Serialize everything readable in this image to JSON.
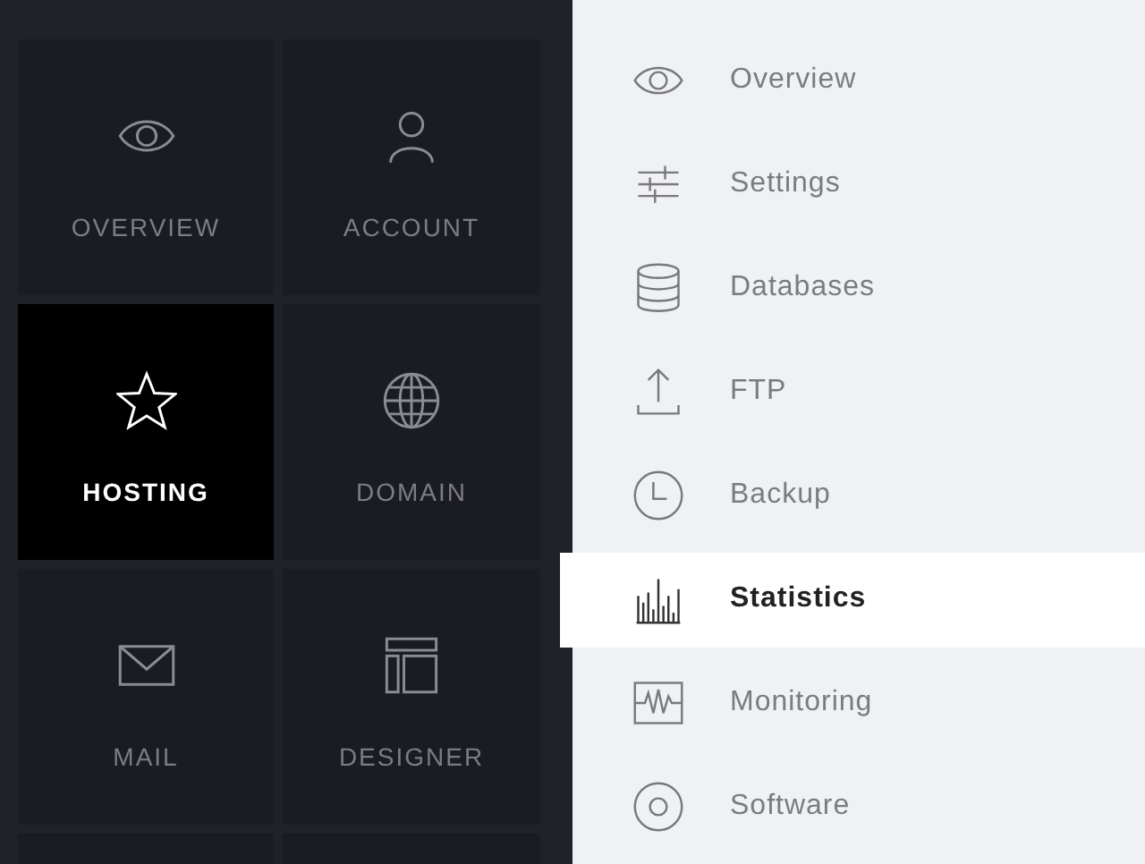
{
  "tiles": [
    {
      "label": "OVERVIEW",
      "selected": false
    },
    {
      "label": "ACCOUNT",
      "selected": false
    },
    {
      "label": "HOSTING",
      "selected": true
    },
    {
      "label": "DOMAIN",
      "selected": false
    },
    {
      "label": "MAIL",
      "selected": false
    },
    {
      "label": "DESIGNER",
      "selected": false
    }
  ],
  "menu": [
    {
      "label": "Overview",
      "selected": false
    },
    {
      "label": "Settings",
      "selected": false
    },
    {
      "label": "Databases",
      "selected": false
    },
    {
      "label": "FTP",
      "selected": false
    },
    {
      "label": "Backup",
      "selected": false
    },
    {
      "label": "Statistics",
      "selected": true
    },
    {
      "label": "Monitoring",
      "selected": false
    },
    {
      "label": "Software",
      "selected": false
    }
  ]
}
